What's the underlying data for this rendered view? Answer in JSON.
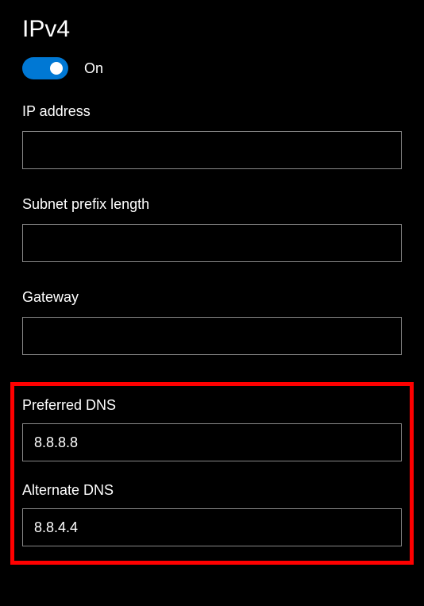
{
  "heading": "IPv4",
  "toggle": {
    "state": "on",
    "label": "On"
  },
  "fields": {
    "ip_address": {
      "label": "IP address",
      "value": ""
    },
    "subnet_prefix": {
      "label": "Subnet prefix length",
      "value": ""
    },
    "gateway": {
      "label": "Gateway",
      "value": ""
    },
    "preferred_dns": {
      "label": "Preferred DNS",
      "value": "8.8.8.8"
    },
    "alternate_dns": {
      "label": "Alternate DNS",
      "value": "8.8.4.4"
    }
  }
}
